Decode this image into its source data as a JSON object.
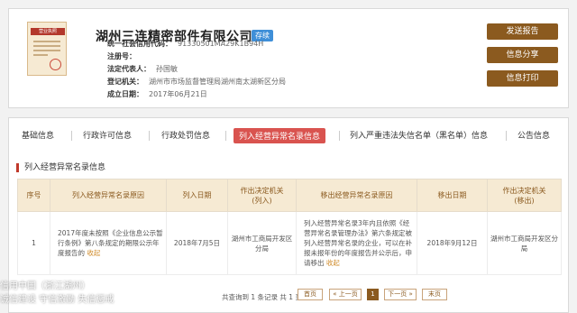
{
  "company": {
    "name": "湖州三连精密部件有限公司",
    "status": "存续",
    "fields": [
      {
        "label": "统一社会信用代码：",
        "value": "91330501MA29K1B94H"
      },
      {
        "label": "注册号：",
        "value": ""
      },
      {
        "label": "法定代表人：",
        "value": "孙国敏"
      },
      {
        "label": "登记机关：",
        "value": "湖州市市场监督管理局湖州南太湖新区分局"
      },
      {
        "label": "成立日期：",
        "value": "2017年06月21日"
      }
    ],
    "license_title": "营业执照"
  },
  "actions": {
    "send_report": "发送报告",
    "share": "信息分享",
    "print": "信息打印"
  },
  "tabs": [
    {
      "label": "基础信息"
    },
    {
      "label": "行政许可信息"
    },
    {
      "label": "行政处罚信息"
    },
    {
      "label": "列入经营异常名录信息",
      "active": true
    },
    {
      "label": "列入严重违法失信名单（黑名单）信息"
    },
    {
      "label": "公告信息"
    }
  ],
  "section_title": "列入经营异常名录信息",
  "table": {
    "headers": [
      "序号",
      "列入经营异常名录原因",
      "列入日期",
      "作出决定机关\n(列入)",
      "移出经营异常名录原因",
      "移出日期",
      "作出决定机关\n(移出)"
    ],
    "rows": [
      {
        "index": "1",
        "reason_in": "2017年度未按照《企业信息公示暂行条例》第八条规定的期限公示年度报告的",
        "date_in": "2018年7月5日",
        "authority_in": "湖州市工商局开发区分局",
        "reason_out": "列入经营异常名录3年内且依照《经营异常名录管理办法》第六条规定被列入经营异常名录的企业，可以在补报未报年份的年度报告并公示后，申请移出",
        "date_out": "2018年9月12日",
        "authority_out": "湖州市工商局开发区分局",
        "collapse": "收起"
      }
    ]
  },
  "pagination": {
    "summary": "共查询到 1 条记录 共 1 页",
    "first": "首页",
    "prev": "« 上一页",
    "current": "1",
    "next": "下一页 »",
    "last": "末页"
  },
  "watermark": {
    "line1": "信用中国（浙江湖州）",
    "line2": "诚信建设 守信激励 失信惩戒"
  },
  "colors": {
    "accent_brown": "#8b5a1f",
    "active_tab_red": "#d9534f",
    "status_blue": "#3f8fd8",
    "table_header_bg": "#f6ead3"
  }
}
